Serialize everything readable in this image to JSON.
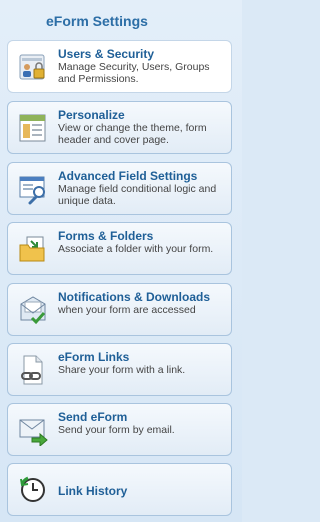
{
  "panel": {
    "title": "eForm Settings"
  },
  "items": [
    {
      "label": "Users & Security",
      "desc": "Manage Security, Users, Groups and Permissions.",
      "icon": "users-security-icon"
    },
    {
      "label": "Personalize",
      "desc": "View or change the theme, form header and cover page.",
      "icon": "personalize-icon"
    },
    {
      "label": "Advanced Field Settings",
      "desc": "Manage field conditional logic and unique data.",
      "icon": "advanced-settings-icon"
    },
    {
      "label": "Forms & Folders",
      "desc": "Associate a folder with your form.",
      "icon": "folder-icon"
    },
    {
      "label": "Notifications & Downloads",
      "desc": "when your form are accessed",
      "icon": "notification-envelope-icon"
    },
    {
      "label": "eForm Links",
      "desc": "Share your form with a link.",
      "icon": "link-icon"
    },
    {
      "label": "Send eForm",
      "desc": "Send your form by email.",
      "icon": "send-email-icon"
    },
    {
      "label": "Link History",
      "desc": "",
      "icon": "history-clock-icon"
    }
  ]
}
